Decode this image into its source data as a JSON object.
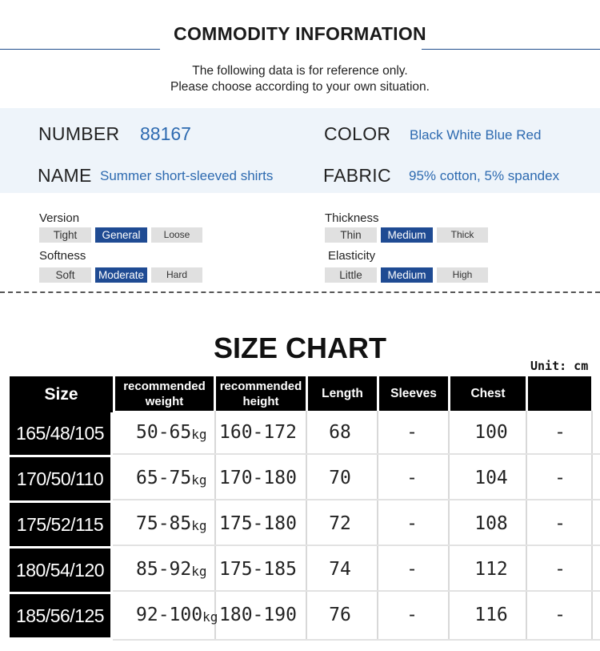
{
  "header": {
    "title": "COMMODITY INFORMATION",
    "note_line1": "The following data is for reference only.",
    "note_line2": "Please choose according to your own situation."
  },
  "info": {
    "number_label": "NUMBER",
    "number_value": "88167",
    "color_label": "COLOR",
    "color_value": "Black White Blue Red",
    "name_label": "NAME",
    "name_value": "Summer short-sleeved shirts",
    "fabric_label": "FABRIC",
    "fabric_value": "95% cotton, 5% spandex"
  },
  "attributes": {
    "version": {
      "label": "Version",
      "options": [
        "Tight",
        "General",
        "Loose"
      ],
      "selected": "General"
    },
    "softness": {
      "label": "Softness",
      "options": [
        "Soft",
        "Moderate",
        "Hard"
      ],
      "selected": "Moderate"
    },
    "thickness": {
      "label": "Thickness",
      "options": [
        "Thin",
        "Medium",
        "Thick"
      ],
      "selected": "Medium"
    },
    "elasticity": {
      "label": "Elasticity",
      "options": [
        "Little",
        "Medium",
        "High"
      ],
      "selected": "Medium"
    }
  },
  "size_chart": {
    "title": "SIZE CHART",
    "unit": "Unit: cm",
    "headers": {
      "size": "Size",
      "weight_l1": "recommended",
      "weight_l2": "weight",
      "height_l1": "recommended",
      "height_l2": "height",
      "length": "Length",
      "sleeves": "Sleeves",
      "chest": "Chest",
      "extra": ""
    },
    "kg_unit": "kg",
    "rows": [
      {
        "size": "165/48/105",
        "weight": "50-65",
        "height": "160-172",
        "length": "68",
        "sleeves": "-",
        "chest": "100",
        "extra": "-"
      },
      {
        "size": "170/50/110",
        "weight": "65-75",
        "height": "170-180",
        "length": "70",
        "sleeves": "-",
        "chest": "104",
        "extra": "-"
      },
      {
        "size": "175/52/115",
        "weight": "75-85",
        "height": "175-180",
        "length": "72",
        "sleeves": "-",
        "chest": "108",
        "extra": "-"
      },
      {
        "size": "180/54/120",
        "weight": "85-92",
        "height": "175-185",
        "length": "74",
        "sleeves": "-",
        "chest": "112",
        "extra": "-"
      },
      {
        "size": "185/56/125",
        "weight": "92-100",
        "height": "180-190",
        "length": "76",
        "sleeves": "-",
        "chest": "116",
        "extra": "-"
      }
    ]
  },
  "colors": {
    "accent_blue": "#1f4b93",
    "value_blue": "#2d6ab0",
    "band_bg": "#eef4fa"
  }
}
